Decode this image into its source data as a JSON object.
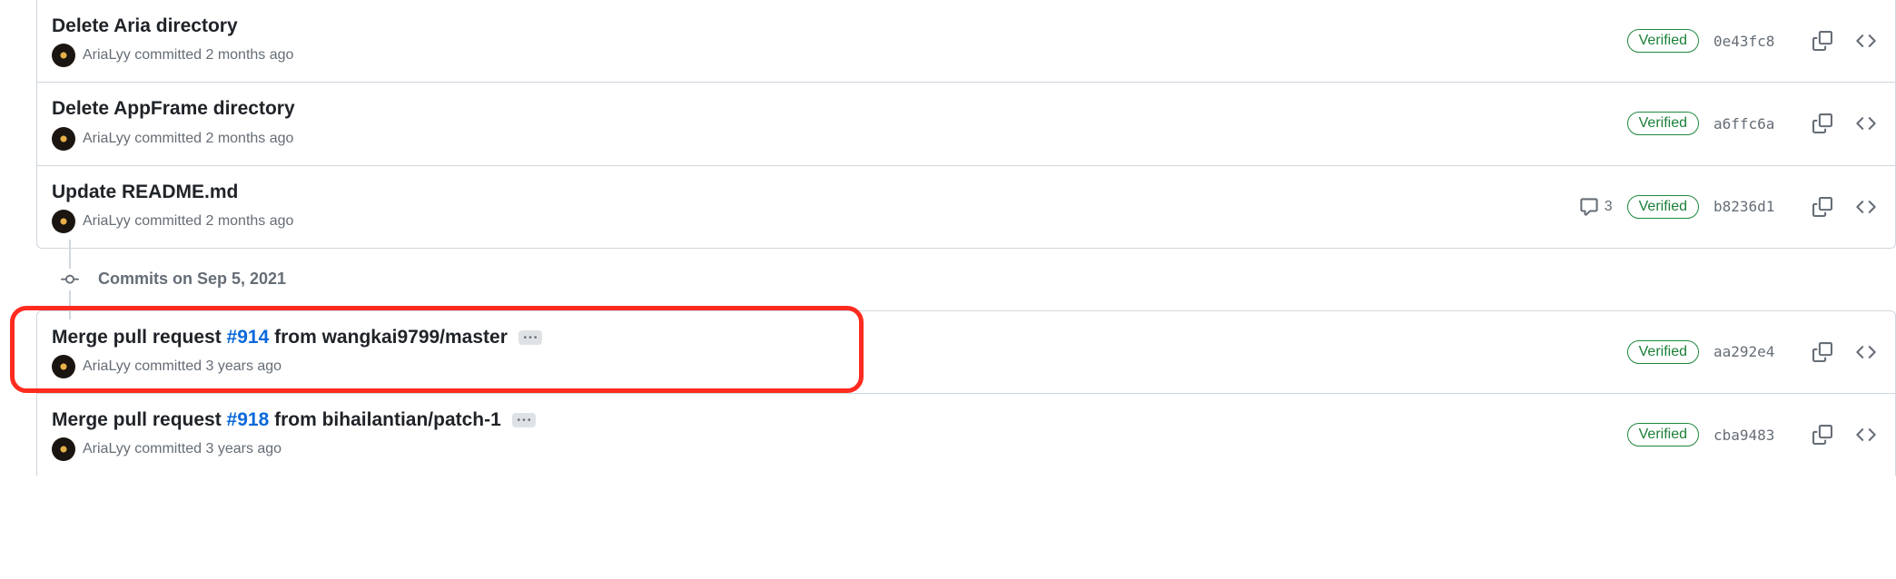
{
  "labels": {
    "verified": "Verified",
    "committed": "committed"
  },
  "group1": {
    "commits": [
      {
        "title": "Delete Aria directory",
        "author": "AriaLyy",
        "time": "2 months ago",
        "sha": "0e43fc8",
        "comments": null,
        "hasEllipsis": false
      },
      {
        "title": "Delete AppFrame directory",
        "author": "AriaLyy",
        "time": "2 months ago",
        "sha": "a6ffc6a",
        "comments": null,
        "hasEllipsis": false
      },
      {
        "title": "Update README.md",
        "author": "AriaLyy",
        "time": "2 months ago",
        "sha": "b8236d1",
        "comments": "3",
        "hasEllipsis": false
      }
    ]
  },
  "divider": {
    "label": "Commits on Sep 5, 2021"
  },
  "group2": {
    "commits": [
      {
        "titlePrefix": "Merge pull request ",
        "pr": "#914",
        "titleSuffix": " from wangkai9799/master",
        "author": "AriaLyy",
        "time": "3 years ago",
        "sha": "aa292e4",
        "comments": null,
        "hasEllipsis": true
      },
      {
        "titlePrefix": "Merge pull request ",
        "pr": "#918",
        "titleSuffix": " from bihailantian/patch-1",
        "author": "AriaLyy",
        "time": "3 years ago",
        "sha": "cba9483",
        "comments": null,
        "hasEllipsis": true
      }
    ]
  }
}
